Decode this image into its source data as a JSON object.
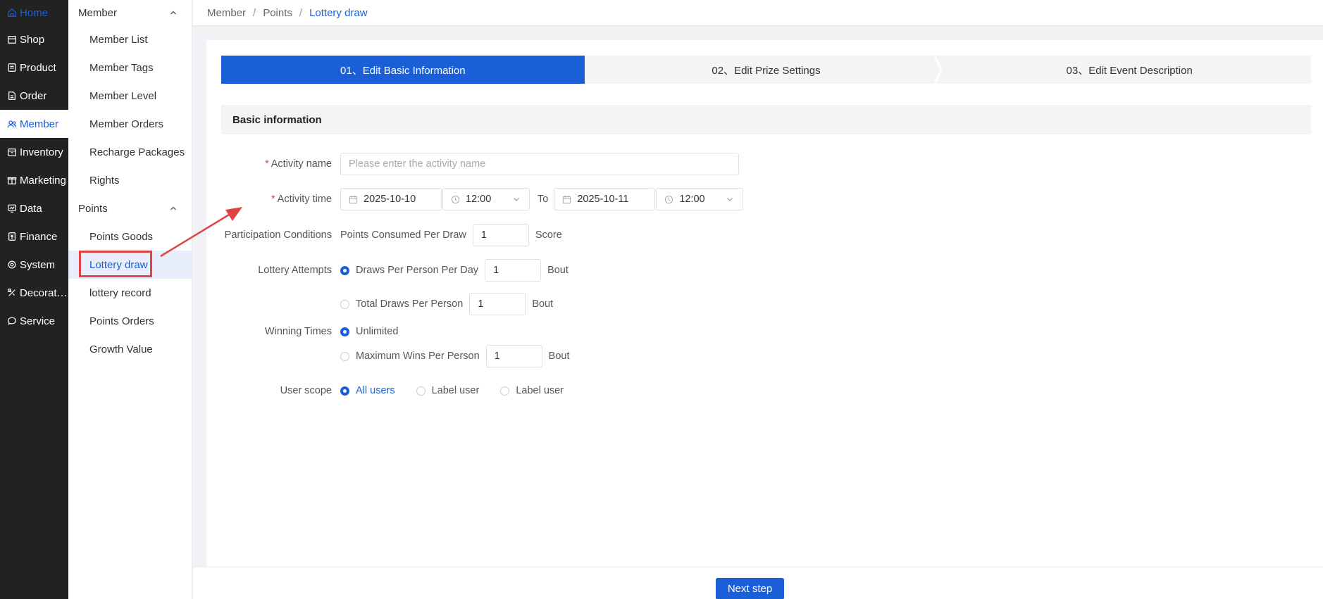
{
  "nav": {
    "items": [
      {
        "label": "Home",
        "icon": "home-icon"
      },
      {
        "label": "Shop",
        "icon": "shop-icon"
      },
      {
        "label": "Product",
        "icon": "product-icon"
      },
      {
        "label": "Order",
        "icon": "order-icon"
      },
      {
        "label": "Member",
        "icon": "member-icon"
      },
      {
        "label": "Inventory",
        "icon": "inventory-icon"
      },
      {
        "label": "Marketing",
        "icon": "marketing-icon"
      },
      {
        "label": "Data",
        "icon": "data-icon"
      },
      {
        "label": "Finance",
        "icon": "finance-icon"
      },
      {
        "label": "System",
        "icon": "system-icon"
      },
      {
        "label": "Decorat…",
        "icon": "decoration-icon"
      },
      {
        "label": "Service",
        "icon": "service-icon"
      }
    ]
  },
  "subnav": {
    "member_group": "Member",
    "member_items": [
      "Member List",
      "Member Tags",
      "Member Level",
      "Member Orders",
      "Recharge Packages",
      "Rights"
    ],
    "points_group": "Points",
    "points_items": [
      "Points Goods",
      "Lottery draw",
      "lottery record",
      "Points Orders",
      "Growth Value"
    ]
  },
  "breadcrumb": [
    "Member",
    "Points",
    "Lottery draw"
  ],
  "steps": [
    "01、Edit Basic Information",
    "02、Edit Prize Settings",
    "03、Edit Event Description"
  ],
  "section_title": "Basic information",
  "form": {
    "activity_name_label": "Activity name",
    "activity_name_placeholder": "Please enter the activity name",
    "activity_time_label": "Activity time",
    "start_date": "2025-10-10",
    "start_time": "12:00",
    "to": "To",
    "end_date": "2025-10-11",
    "end_time": "12:00",
    "participation_label": "Participation Conditions",
    "points_per_draw_label": "Points Consumed Per Draw",
    "points_per_draw_value": "1",
    "points_unit": "Score",
    "attempts_label": "Lottery Attempts",
    "draws_per_day_label": "Draws Per Person Per Day",
    "draws_per_day_value": "1",
    "total_draws_label": "Total Draws Per Person",
    "total_draws_value": "1",
    "bout": "Bout",
    "winning_label": "Winning Times",
    "unlimited": "Unlimited",
    "max_wins_label": "Maximum Wins Per Person",
    "max_wins_value": "1",
    "scope_label": "User scope",
    "scope_all": "All users",
    "scope_label_user_1": "Label user",
    "scope_label_user_2": "Label user"
  },
  "next_button": "Next step",
  "colors": {
    "accent": "#1a5fd8",
    "sidebar": "#222222",
    "highlight": "#e04343"
  }
}
